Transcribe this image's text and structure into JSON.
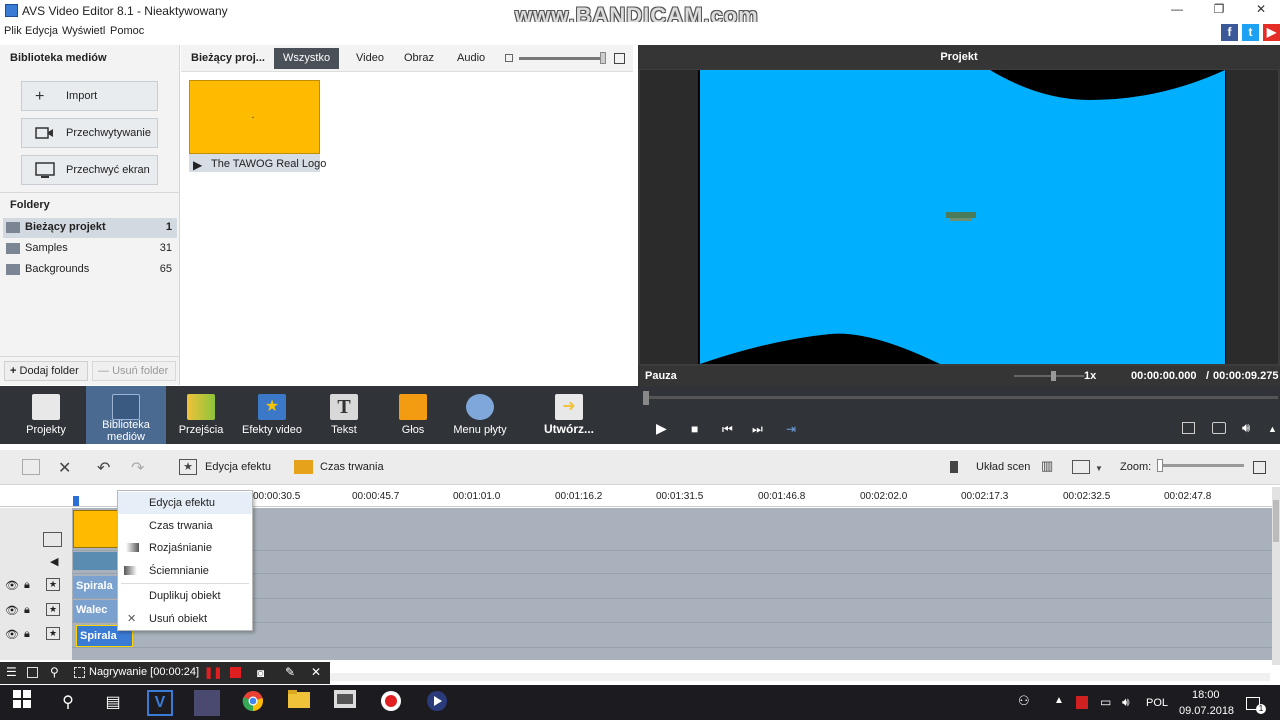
{
  "window": {
    "title": "AVS Video Editor 8.1 - Nieaktywowany",
    "watermark": "www.BANDICAM.com",
    "minimize": "—",
    "maximize": "❐",
    "close": "✕"
  },
  "menu": [
    "Plik",
    "Edycja",
    "Wyświetl",
    "Pomoc"
  ],
  "social": [
    {
      "name": "facebook",
      "glyph": "f",
      "color": "#3b5998"
    },
    {
      "name": "twitter",
      "glyph": "t",
      "color": "#1da1f2"
    },
    {
      "name": "youtube",
      "glyph": "▶",
      "color": "#e52d27"
    }
  ],
  "media_panel": {
    "title": "Biblioteka mediów",
    "buttons": [
      {
        "label": "Import",
        "icon": "plus-icon"
      },
      {
        "label": "Przechwytywanie",
        "icon": "camera-icon"
      },
      {
        "label": "Przechwyć ekran",
        "icon": "screen-capture-icon"
      }
    ],
    "folders_title": "Foldery",
    "folders": [
      {
        "name": "Bieżący projekt",
        "count": "1"
      },
      {
        "name": "Samples",
        "count": "31"
      },
      {
        "name": "Backgrounds",
        "count": "65"
      }
    ],
    "add_folder": "Dodaj folder",
    "remove_folder": "Usuń folder"
  },
  "media_tabs": {
    "current": "Bieżący proj...",
    "tabs": [
      "Wszystko",
      "Video",
      "Obraz",
      "Audio"
    ],
    "active": "Wszystko"
  },
  "media_items": [
    {
      "label": "The TAWOG Real Logo",
      "thumb_color": "#ffbb00"
    }
  ],
  "preview": {
    "title": "Projekt",
    "status": "Pauza",
    "speed": "1x",
    "time_current": "00:00:00.000",
    "separator": "/",
    "time_total": "00:00:09.275",
    "canvas_color": "#00b0ff"
  },
  "main_toolbar": [
    {
      "label": "Projekty",
      "color": "#e8e8e8"
    },
    {
      "label": "Biblioteka mediów",
      "color": "#4a6a92",
      "selected": true
    },
    {
      "label": "Przejścia",
      "color": "#f0c23a"
    },
    {
      "label": "Efekty video",
      "color": "#3c78c8"
    },
    {
      "label": "Tekst",
      "color": "#d8d8d8"
    },
    {
      "label": "Głos",
      "color": "#f39c12"
    },
    {
      "label": "Menu płyty",
      "color": "#7fa7d9"
    },
    {
      "label": "Utwórz...",
      "color": "#f0c23a"
    }
  ],
  "playback": {
    "play": "▶",
    "stop": "■",
    "prev": "⏮",
    "next": "⏭",
    "snap": "⇥"
  },
  "timeline_toolbar": {
    "effect_edit": "Edycja efektu",
    "duration": "Czas trwania",
    "scene_layout": "Układ scen",
    "zoom": "Zoom:"
  },
  "ruler": [
    "00:00:30.5",
    "00:00:45.7",
    "00:01:01.0",
    "00:01:16.2",
    "00:01:31.5",
    "00:01:46.8",
    "00:02:02.0",
    "00:02:17.3",
    "00:02:32.5",
    "00:02:47.8"
  ],
  "clips": [
    {
      "label": "Spirala"
    },
    {
      "label": "Walec"
    },
    {
      "label": "Spirala"
    }
  ],
  "context_menu": [
    {
      "label": "Edycja efektu",
      "icon": ""
    },
    {
      "label": "Czas trwania",
      "icon": ""
    },
    {
      "label": "Rozjaśnianie",
      "icon": "fade-in-icon"
    },
    {
      "label": "Ściemnianie",
      "icon": "fade-out-icon"
    },
    {
      "label": "Duplikuj obiekt",
      "icon": ""
    },
    {
      "label": "Usuń obiekt",
      "icon": "delete-icon"
    }
  ],
  "recorder": {
    "label": "Nagrywanie [00:00:24]"
  },
  "taskbar": {
    "language": "POL",
    "time": "18:00",
    "date": "09.07.2018",
    "notifications": "1"
  }
}
